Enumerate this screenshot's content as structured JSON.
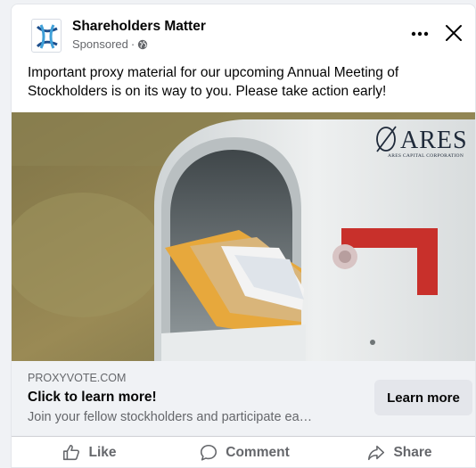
{
  "post": {
    "page_name": "Shareholders Matter",
    "sponsored_label": "Sponsored",
    "separator": "·",
    "caption": "Important proxy material for our upcoming Annual Meeting of Stockholders is on its way to you. Please take action early!",
    "image": {
      "logo_text": "ARES",
      "logo_subtext": "ARES CAPITAL CORPORATION"
    },
    "link": {
      "domain": "PROXYVOTE.COM",
      "headline": "Click to learn more!",
      "description": "Join your fellow stockholders and participate ea…",
      "cta": "Learn more"
    }
  },
  "actions": {
    "like": "Like",
    "comment": "Comment",
    "share": "Share"
  },
  "colors": {
    "brand_blue": "#1c4e8c",
    "mailbox_flag": "#c8302b",
    "secondary_text": "#65676b"
  },
  "icons": [
    "page-logo-icon",
    "globe-icon",
    "more-icon",
    "close-icon",
    "like-icon",
    "comment-icon",
    "share-icon"
  ]
}
